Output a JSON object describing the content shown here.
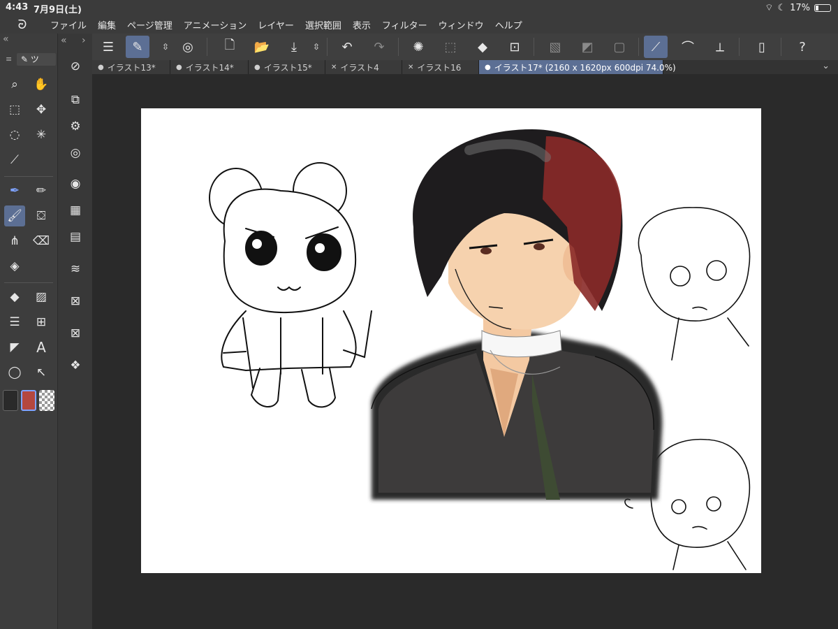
{
  "status": {
    "time": "4:43",
    "date": "7月9日(土)",
    "battery": "17%"
  },
  "menu": [
    "ファイル",
    "編集",
    "ページ管理",
    "アニメーション",
    "レイヤー",
    "選択範囲",
    "表示",
    "フィルター",
    "ウィンドウ",
    "ヘルプ"
  ],
  "tool_panel": {
    "header_label": "ツ"
  },
  "tabs": [
    {
      "label": "イラスト13*",
      "mark": "●"
    },
    {
      "label": "イラスト14*",
      "mark": "●"
    },
    {
      "label": "イラスト15*",
      "mark": "●"
    },
    {
      "label": "イラスト4",
      "mark": "✕"
    },
    {
      "label": "イラスト16",
      "mark": "✕"
    },
    {
      "label": "イラスト17* (2160 x 1620px 600dpi 74.0%)",
      "mark": "●"
    }
  ],
  "colors": {
    "main": "#2a2a2a",
    "sub": "#b4473f",
    "accent": "#5c6f94"
  }
}
